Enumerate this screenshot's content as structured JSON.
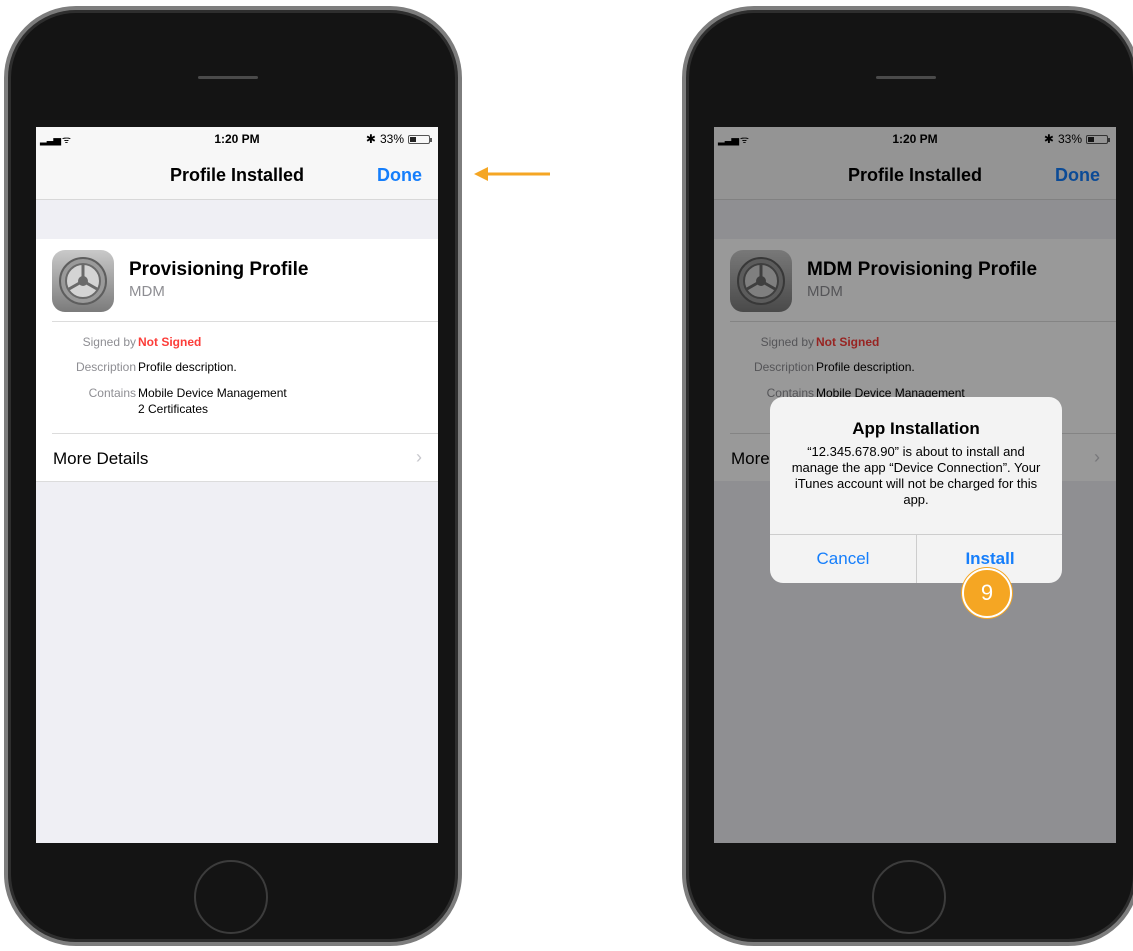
{
  "colors": {
    "accent": "#157efb",
    "warning": "#fc3d39",
    "callout": "#f5a623"
  },
  "left_phone": {
    "status": {
      "time": "1:20 PM",
      "battery": "33%",
      "battery_level": 0.33,
      "icons": [
        "signal-icon",
        "wifi-icon",
        "bluetooth-icon",
        "battery-icon"
      ]
    },
    "nav": {
      "title": "Profile Installed",
      "done": "Done"
    },
    "profile": {
      "name": "Provisioning Profile",
      "org": "MDM",
      "icon": "settings-gear-icon",
      "fields": {
        "signed_by_label": "Signed by",
        "signed_by_value": "Not Signed",
        "description_label": "Description",
        "description_value": "Profile description.",
        "contains_label": "Contains",
        "contains_value_1": "Mobile Device Management",
        "contains_value_2": "2 Certificates"
      },
      "more_details": "More Details"
    }
  },
  "right_phone": {
    "status": {
      "time": "1:20 PM",
      "battery": "33%",
      "battery_level": 0.33
    },
    "nav": {
      "title": "Profile Installed",
      "done": "Done"
    },
    "profile": {
      "name": "MDM Provisioning Profile",
      "org": "MDM",
      "fields": {
        "signed_by_label": "Signed by",
        "signed_by_value": "Not Signed",
        "description_label": "Description",
        "description_value": "Profile description.",
        "contains_label": "Contains",
        "contains_value_1": "Mobile Device Management"
      },
      "more_details": "More"
    },
    "alert": {
      "title": "App Installation",
      "message": "“12.345.678.90” is about to install and manage the app “Device Connection”. Your iTunes account will not be charged for this app.",
      "cancel": "Cancel",
      "install": "Install"
    }
  },
  "annotations": {
    "step_number": "9",
    "arrow": "arrow-left-icon"
  }
}
